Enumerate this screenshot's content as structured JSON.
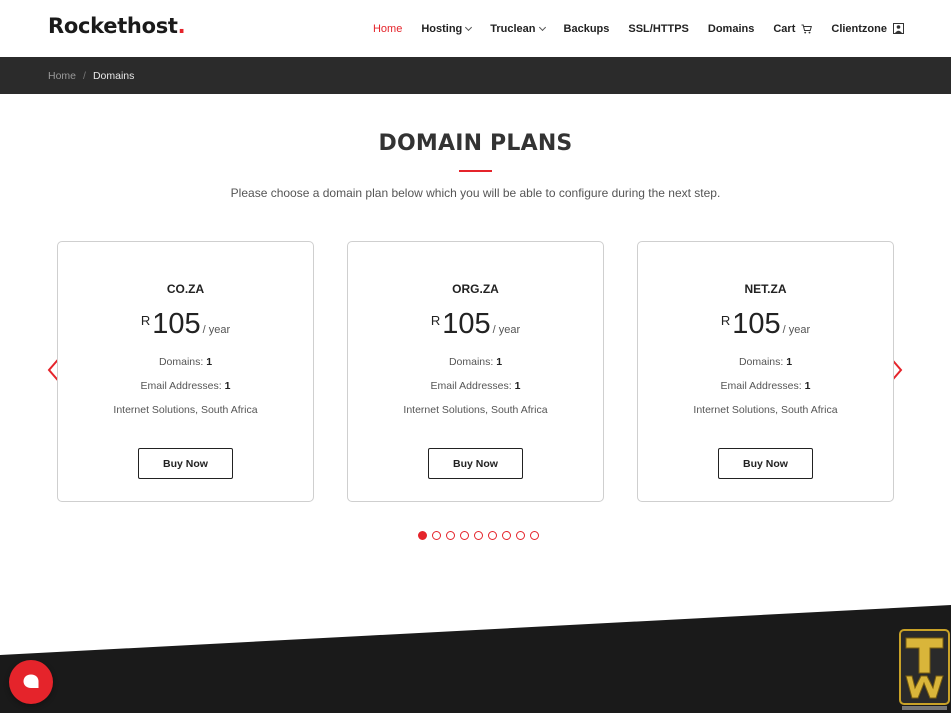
{
  "brand": {
    "name": "Rockethost",
    "dot": "."
  },
  "nav": {
    "items": [
      {
        "label": "Home"
      },
      {
        "label": "Hosting"
      },
      {
        "label": "Truclean"
      },
      {
        "label": "Backups"
      },
      {
        "label": "SSL/HTTPS"
      },
      {
        "label": "Domains"
      },
      {
        "label": "Cart"
      },
      {
        "label": "Clientzone"
      }
    ]
  },
  "breadcrumb": {
    "home": "Home",
    "separator": "/",
    "current": "Domains"
  },
  "main": {
    "title": "DOMAIN PLANS",
    "subtitle": "Please choose a domain plan below which you will be able to configure during the next step."
  },
  "plans": [
    {
      "name": "CO.ZA",
      "currency": "R",
      "amount": "105",
      "period": "/ year",
      "domains_label": "Domains:",
      "domains": "1",
      "email_label": "Email Addresses:",
      "email": "1",
      "provider": "Internet Solutions, South Africa",
      "button": "Buy Now"
    },
    {
      "name": "ORG.ZA",
      "currency": "R",
      "amount": "105",
      "period": "/ year",
      "domains_label": "Domains:",
      "domains": "1",
      "email_label": "Email Addresses:",
      "email": "1",
      "provider": "Internet Solutions, South Africa",
      "button": "Buy Now"
    },
    {
      "name": "NET.ZA",
      "currency": "R",
      "amount": "105",
      "period": "/ year",
      "domains_label": "Domains:",
      "domains": "1",
      "email_label": "Email Addresses:",
      "email": "1",
      "provider": "Internet Solutions, South Africa",
      "button": "Buy Now"
    }
  ],
  "carousel": {
    "page_count": 9,
    "active_page": 1
  },
  "icons": {
    "prev": "chevron-left-icon",
    "next": "chevron-right-icon",
    "cart": "cart-icon",
    "user": "user-icon",
    "chat": "chat-bubble-icon"
  },
  "colors": {
    "accent": "#e5242b",
    "dark_bar": "#2b2b2b",
    "footer": "#1a1a1a"
  }
}
